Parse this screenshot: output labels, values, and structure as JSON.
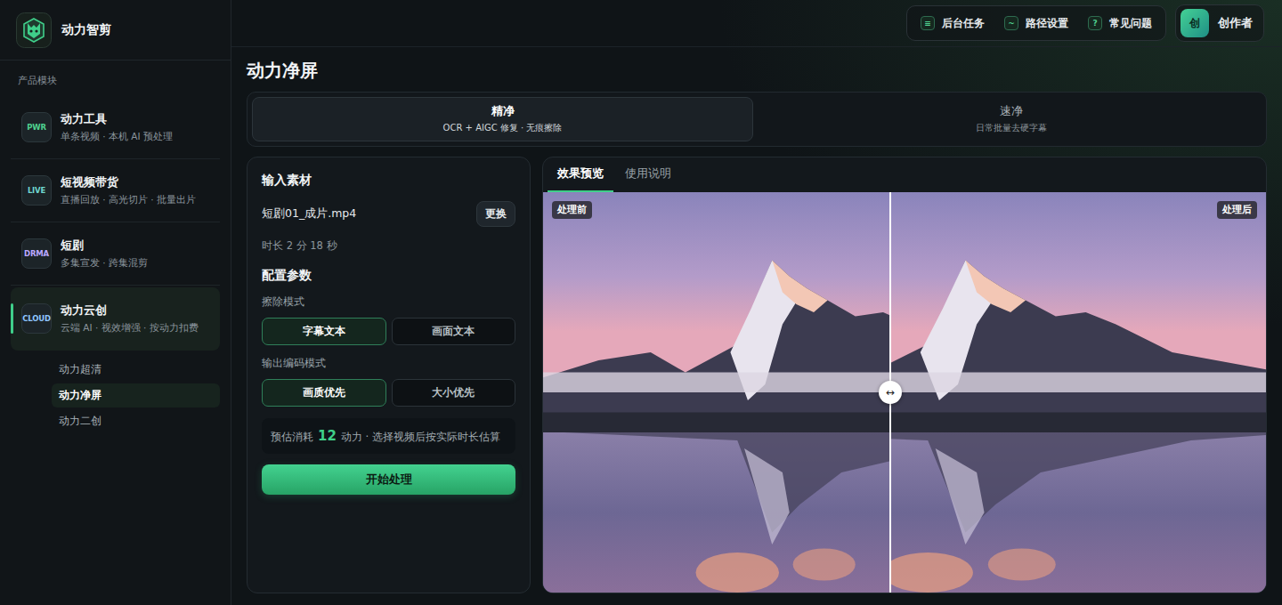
{
  "app": {
    "name": "动力智剪"
  },
  "sidebar": {
    "section_label": "产品模块",
    "items": [
      {
        "badge": "PWR",
        "title": "动力工具",
        "subtitle": "单条视频 · 本机 AI 预处理",
        "color": "#4fd08f",
        "selected": false
      },
      {
        "badge": "LIVE",
        "title": "短视频带货",
        "subtitle": "直播回放 · 高光切片 · 批量出片",
        "color": "#6fd6cf",
        "selected": false
      },
      {
        "badge": "DRMA",
        "title": "短剧",
        "subtitle": "多集宣发 · 跨集混剪",
        "color": "#b9a8ff",
        "selected": false
      },
      {
        "badge": "CLOUD",
        "title": "动力云创",
        "subtitle": "云端 AI · 视效增强 · 按动力扣费",
        "color": "#8fc6ff",
        "selected": true,
        "children": [
          {
            "label": "动力超清",
            "selected": false
          },
          {
            "label": "动力净屏",
            "selected": true
          },
          {
            "label": "动力二创",
            "selected": false
          }
        ]
      }
    ]
  },
  "topbar": {
    "actions": [
      {
        "icon": "≡",
        "label": "后台任务"
      },
      {
        "icon": "~",
        "label": "路径设置"
      },
      {
        "icon": "?",
        "label": "常见问题"
      }
    ],
    "user": {
      "avatar": "创",
      "name": "创作者"
    }
  },
  "page": {
    "title": "动力净屏"
  },
  "modes": [
    {
      "title": "精净",
      "subtitle": "OCR + AIGC 修复 · 无痕擦除",
      "selected": true
    },
    {
      "title": "速净",
      "subtitle": "日常批量去硬字幕",
      "selected": false
    }
  ],
  "input_panel": {
    "title": "输入素材",
    "file_name": "短剧01_成片.mp4",
    "change_button": "更换",
    "duration": "时长 2 分 18 秒",
    "config_title": "配置参数",
    "erase_mode": {
      "label": "擦除模式",
      "options": [
        {
          "label": "字幕文本",
          "selected": true
        },
        {
          "label": "画面文本",
          "selected": false
        }
      ]
    },
    "encode_mode": {
      "label": "输出编码模式",
      "options": [
        {
          "label": "画质优先",
          "selected": true
        },
        {
          "label": "大小优先",
          "selected": false
        }
      ]
    },
    "estimate": {
      "prefix": "预估消耗",
      "value": "12",
      "suffix": "动力 · 选择视频后按实际时长估算"
    },
    "start_button": "开始处理"
  },
  "preview": {
    "tabs": [
      {
        "label": "效果预览",
        "selected": true
      },
      {
        "label": "使用说明",
        "selected": false
      }
    ],
    "before_label": "处理前",
    "after_label": "处理后",
    "handle_icon": "↔",
    "split": 0.48
  }
}
